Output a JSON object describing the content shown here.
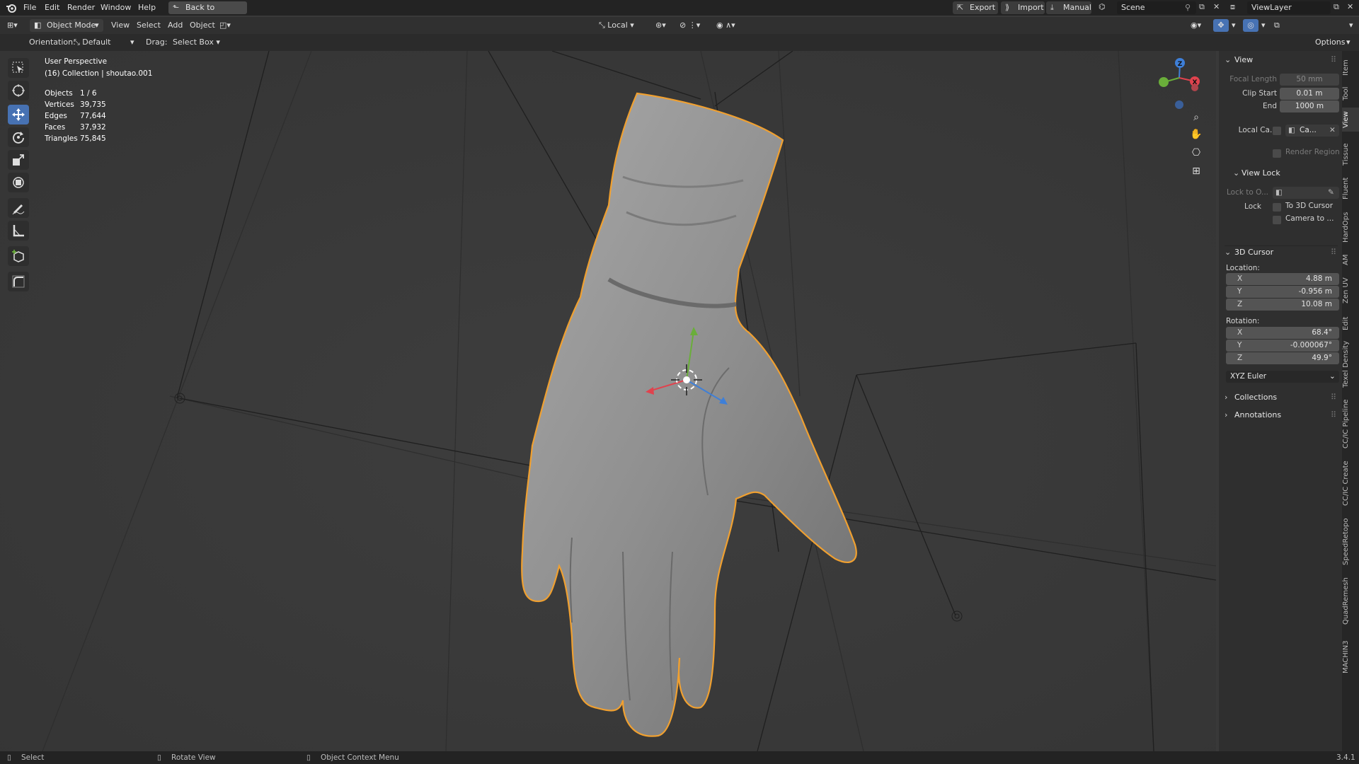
{
  "menubar": {
    "items": [
      "File",
      "Edit",
      "Render",
      "Window",
      "Help"
    ],
    "back_label": "Back to Previous",
    "export_label": "Export",
    "import_label": "Import",
    "manual_label": "Manual",
    "scene_label": "Scene",
    "viewlayer_label": "ViewLayer"
  },
  "header": {
    "mode_label": "Object Mode",
    "menus": [
      "View",
      "Select",
      "Add",
      "Object"
    ],
    "pivot_label": "Local",
    "orientation_label": "Orientation:",
    "orientation_value": "Default",
    "drag_label": "Drag:",
    "drag_value": "Select Box",
    "options_label": "Options"
  },
  "viewport": {
    "perspective": "User Perspective",
    "collection": "(16) Collection | shoutao.001",
    "stats": [
      {
        "label": "Objects",
        "value": "1 / 6"
      },
      {
        "label": "Vertices",
        "value": "39,735"
      },
      {
        "label": "Edges",
        "value": "77,644"
      },
      {
        "label": "Faces",
        "value": "37,932"
      },
      {
        "label": "Triangles",
        "value": "75,845"
      }
    ],
    "gizmo": {
      "x": "X",
      "y": "Y",
      "z": "Z"
    }
  },
  "npanel": {
    "view_title": "View",
    "focal_label": "Focal Length",
    "focal_value": "50 mm",
    "clip_start_label": "Clip Start",
    "clip_start_value": "0.01 m",
    "clip_end_label": "End",
    "clip_end_value": "1000 m",
    "local_camera_label": "Local Ca...",
    "local_camera_value": "Ca...",
    "render_region_label": "Render Region",
    "view_lock_title": "View Lock",
    "lock_object_label": "Lock to O...",
    "lock_label": "Lock",
    "to_cursor_label": "To 3D Cursor",
    "camera_to_label": "Camera to ...",
    "cursor_title": "3D Cursor",
    "location_label": "Location:",
    "location": [
      {
        "axis": "X",
        "value": "4.88 m"
      },
      {
        "axis": "Y",
        "value": "-0.956 m"
      },
      {
        "axis": "Z",
        "value": "10.08 m"
      }
    ],
    "rotation_label": "Rotation:",
    "rotation": [
      {
        "axis": "X",
        "value": "68.4°"
      },
      {
        "axis": "Y",
        "value": "-0.000067°"
      },
      {
        "axis": "Z",
        "value": "49.9°"
      }
    ],
    "rotation_mode": "XYZ Euler",
    "collections_title": "Collections",
    "annotations_title": "Annotations"
  },
  "tabs": [
    "Item",
    "Tool",
    "View",
    "Tissue",
    "Fluent",
    "HardOps",
    "AM",
    "Zen UV",
    "Edit",
    "Texel Density",
    "CC/IC Pipeline",
    "CC/IC Create",
    "SpeedRetopo",
    "QuadRemesh",
    "MACHIN3"
  ],
  "statusbar": {
    "select": "Select",
    "rotate": "Rotate View",
    "context": "Object Context Menu",
    "version": "3.4.1"
  },
  "colors": {
    "accent": "#4772b3",
    "selection_outline": "#f0a030",
    "axis_x": "#e0434e",
    "axis_y": "#6aae3a",
    "axis_z": "#3e7fd8"
  }
}
